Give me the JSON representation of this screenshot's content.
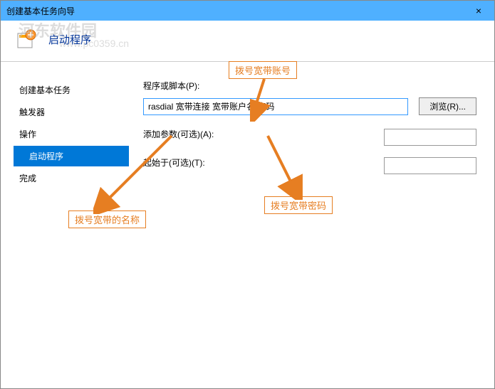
{
  "window": {
    "title": "创建基本任务向导",
    "close": "×"
  },
  "header": {
    "title": "启动程序"
  },
  "watermark": {
    "text": "河东软件园",
    "url": "www.pc0359.cn"
  },
  "sidebar": {
    "items": [
      {
        "label": "创建基本任务"
      },
      {
        "label": "触发器"
      },
      {
        "label": "操作"
      },
      {
        "label": "启动程序"
      },
      {
        "label": "完成"
      }
    ]
  },
  "form": {
    "program_label": "程序或脚本(P):",
    "program_value": "rasdial 宽带连接 宽带账户名 密码",
    "browse_label": "浏览(R)...",
    "args_label": "添加参数(可选)(A):",
    "args_value": "",
    "start_in_label": "起始于(可选)(T):",
    "start_in_value": ""
  },
  "annotations": {
    "name": "拨号宽带的名称",
    "account": "拨号宽带账号",
    "password": "拨号宽带密码"
  },
  "colors": {
    "accent": "#e67e22",
    "titlebar": "#4fb0ff",
    "selection": "#0078d7"
  }
}
